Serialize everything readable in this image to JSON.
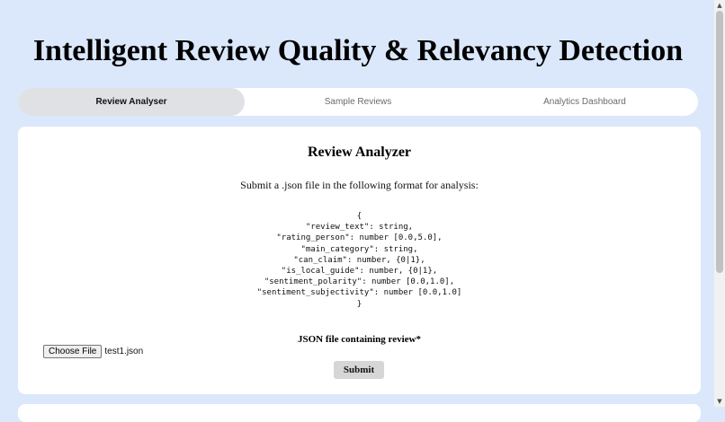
{
  "page": {
    "title": "Intelligent Review Quality & Relevancy Detection"
  },
  "tabs": [
    {
      "label": "Review Analyser",
      "active": true
    },
    {
      "label": "Sample Reviews",
      "active": false
    },
    {
      "label": "Analytics Dashboard",
      "active": false
    }
  ],
  "analyzer": {
    "heading": "Review Analyzer",
    "instructions": "Submit a .json file in the following format for analysis:",
    "format_lines": [
      "{",
      "\"review_text\": string,",
      "\"rating_person\": number [0.0,5.0],",
      "\"main_category\": string,",
      "\"can_claim\": number, {0|1},",
      "\"is_local_guide\": number, {0|1},",
      "\"sentiment_polarity\": number [0.0,1.0],",
      "\"sentiment_subjectivity\": number [0.0,1.0]",
      "}"
    ],
    "file_label": "JSON file containing review*",
    "choose_file_label": "Choose File",
    "file_name": "test1.json",
    "submit_label": "Submit"
  },
  "scrollbar": {
    "up_icon": "▲",
    "down_icon": "▼"
  }
}
